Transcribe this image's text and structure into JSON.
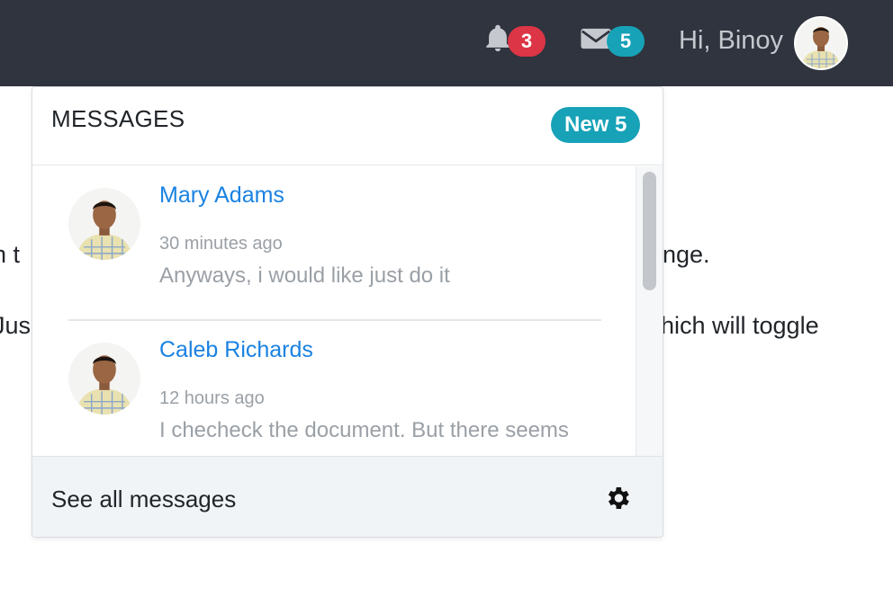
{
  "navbar": {
    "notifications_count": "3",
    "messages_count": "5",
    "greeting": "Hi, Binoy",
    "colors": {
      "bar": "#2f343e",
      "danger": "#dc3545",
      "info": "#17a2b8"
    }
  },
  "background_text": {
    "line1_left": "n t",
    "line1_right": "nge.",
    "line2_left": "Jus",
    "line2_right": "hich will toggle"
  },
  "dropdown": {
    "title": "MESSAGES",
    "new_badge": "New 5",
    "messages": [
      {
        "name": "Mary Adams",
        "time": "30 minutes ago",
        "text": "Anyways, i would like just do it"
      },
      {
        "name": "Caleb Richards",
        "time": "12 hours ago",
        "text": "I checheck the document. But there seems"
      }
    ],
    "footer_label": "See all messages",
    "icons": {
      "settings": "gear-icon",
      "bell": "bell-icon",
      "mail": "envelope-icon"
    }
  }
}
